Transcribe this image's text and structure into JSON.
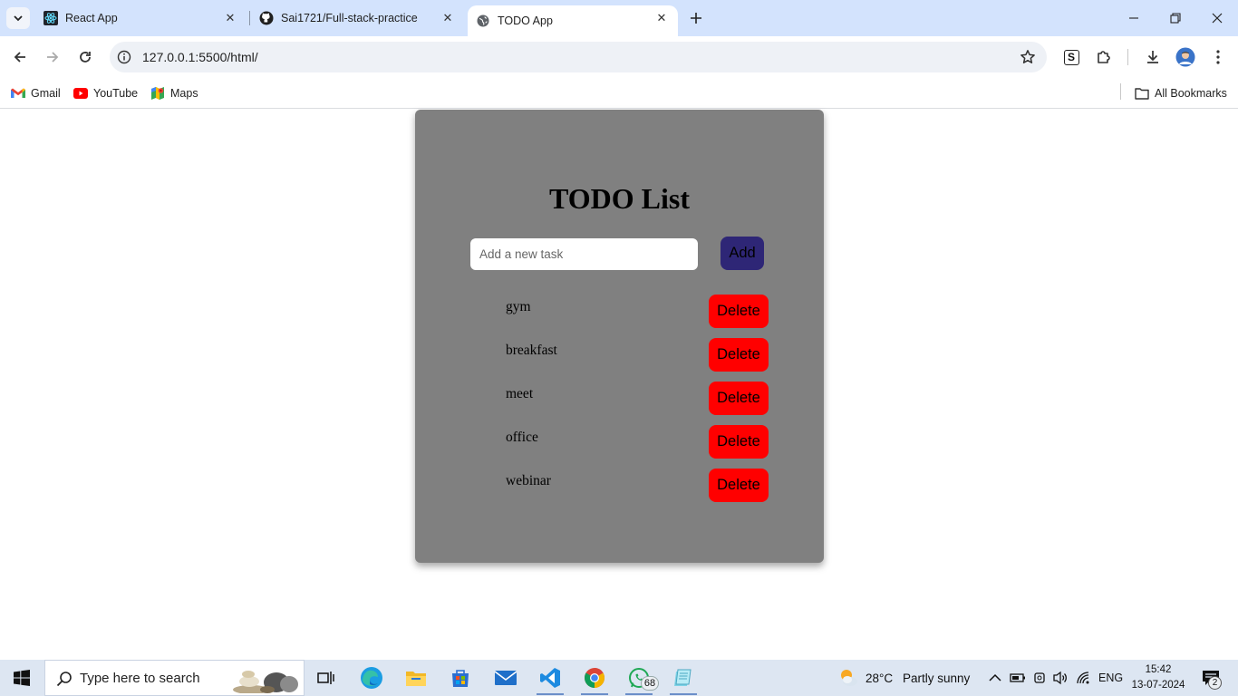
{
  "browser": {
    "tabs": [
      {
        "title": "React App",
        "icon": "react-icon"
      },
      {
        "title": "Sai1721/Full-stack-practice",
        "icon": "github-icon"
      },
      {
        "title": "TODO App",
        "icon": "globe-icon",
        "active": true
      }
    ],
    "url": "127.0.0.1:5500/html/",
    "bookmarks": [
      {
        "label": "Gmail",
        "icon": "gmail-icon"
      },
      {
        "label": "YouTube",
        "icon": "youtube-icon"
      },
      {
        "label": "Maps",
        "icon": "maps-icon"
      }
    ],
    "all_bookmarks_label": "All Bookmarks",
    "profile_extension_letter": "S"
  },
  "app": {
    "title": "TODO List",
    "input_placeholder": "Add a new task",
    "input_value": "",
    "add_label": "Add",
    "delete_label": "Delete",
    "tasks": [
      "gym",
      "breakfast",
      "meet",
      "office",
      "webinar"
    ]
  },
  "taskbar": {
    "search_placeholder": "Type here to search",
    "whatsapp_badge": "68",
    "weather_temp": "28°C",
    "weather_desc": "Partly sunny",
    "language": "ENG",
    "time": "15:42",
    "date": "13-07-2024",
    "notification_count": "2"
  },
  "colors": {
    "card": "#808080",
    "add_button": "#2e2676",
    "delete_button": "#ff0000",
    "tabstrip": "#d3e3fd"
  }
}
